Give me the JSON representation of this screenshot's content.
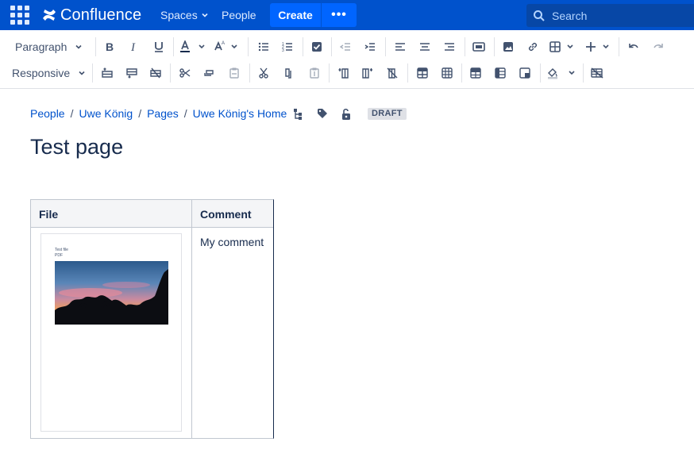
{
  "nav": {
    "brand": "Confluence",
    "spaces": "Spaces",
    "people": "People",
    "create": "Create",
    "more": "•••",
    "search_placeholder": "Search"
  },
  "toolbar": {
    "paragraph": "Paragraph",
    "responsive": "Responsive"
  },
  "breadcrumb": [
    "People",
    "Uwe König",
    "Pages",
    "Uwe König's Home"
  ],
  "draft_badge": "DRAFT",
  "page_title": "Test page",
  "table": {
    "headers": [
      "File",
      "Comment"
    ],
    "rows": [
      {
        "comment": "My comment",
        "preview_line1": "Test file",
        "preview_line2": "PDF"
      }
    ]
  },
  "colors": {
    "nav_bg": "#0052cc",
    "create_bg": "#0065ff",
    "search_bg": "#0747a6",
    "link": "#0052cc",
    "text": "#172b4d"
  }
}
